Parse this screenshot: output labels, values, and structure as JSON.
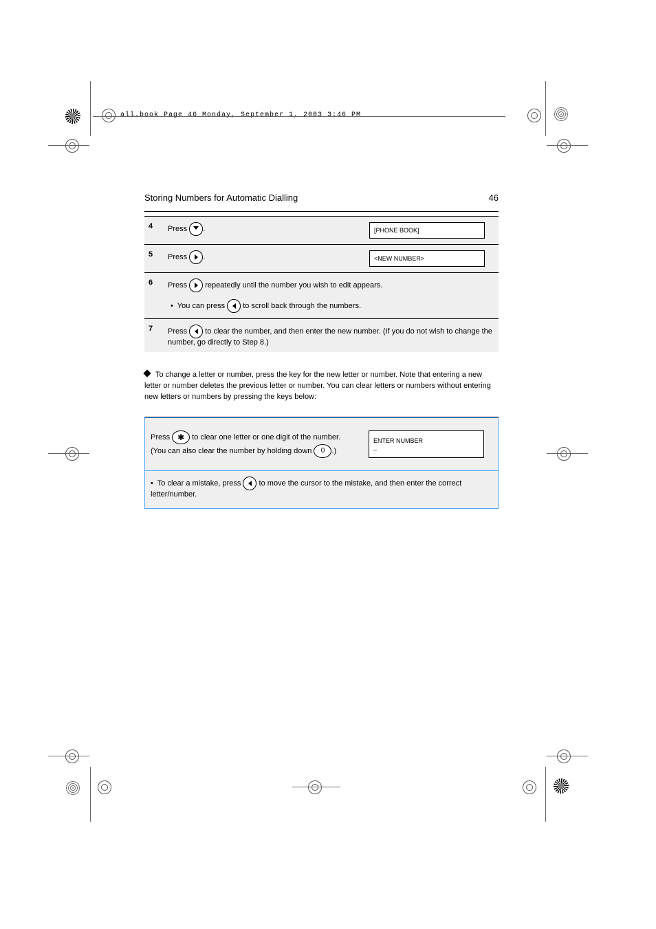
{
  "header_runner": "all.book  Page 46  Monday, September 1, 2003  3:46 PM",
  "section_title": "Storing Numbers for Automatic Dialling",
  "page_number": "46",
  "table1": {
    "row4": {
      "num": "4",
      "text_before": "Press ",
      "text_after": ".",
      "disp": "[PHONE BOOK]"
    },
    "row5": {
      "num": "5",
      "text_before": "Press ",
      "text_after": ".",
      "disp": "<NEW NUMBER>"
    },
    "row6": {
      "num": "6",
      "text_before": "Press ",
      "text_after": " repeatedly until the number you wish to edit appears.",
      "bullet": "You can press ",
      "bullet_after": " to scroll back through the numbers."
    },
    "row7": {
      "num": "7",
      "text_before": "Press ",
      "text_after": " to clear the number, and then enter the new number. (If you do not wish to change the number, go directly to Step 8.)"
    }
  },
  "bodypara": {
    "line1": "To change a letter or number, press the key for the new letter or number. Note that entering a new letter or number deletes the previous letter or number. You can clear letters or numbers without entering new letters or numbers by pressing the keys below:"
  },
  "table2": {
    "row1": {
      "lead": "Press ",
      "after_star": " to clear one letter or one digit of the number. (You can also clear the number by holding down ",
      "after_zero": ".)",
      "disp1": "ENTER NUMBER",
      "disp2": "_"
    },
    "row2": {
      "bullet": "To clear a mistake, press ",
      "bullet_after": " to move the cursor to the mistake, and then enter the correct letter/number."
    }
  }
}
